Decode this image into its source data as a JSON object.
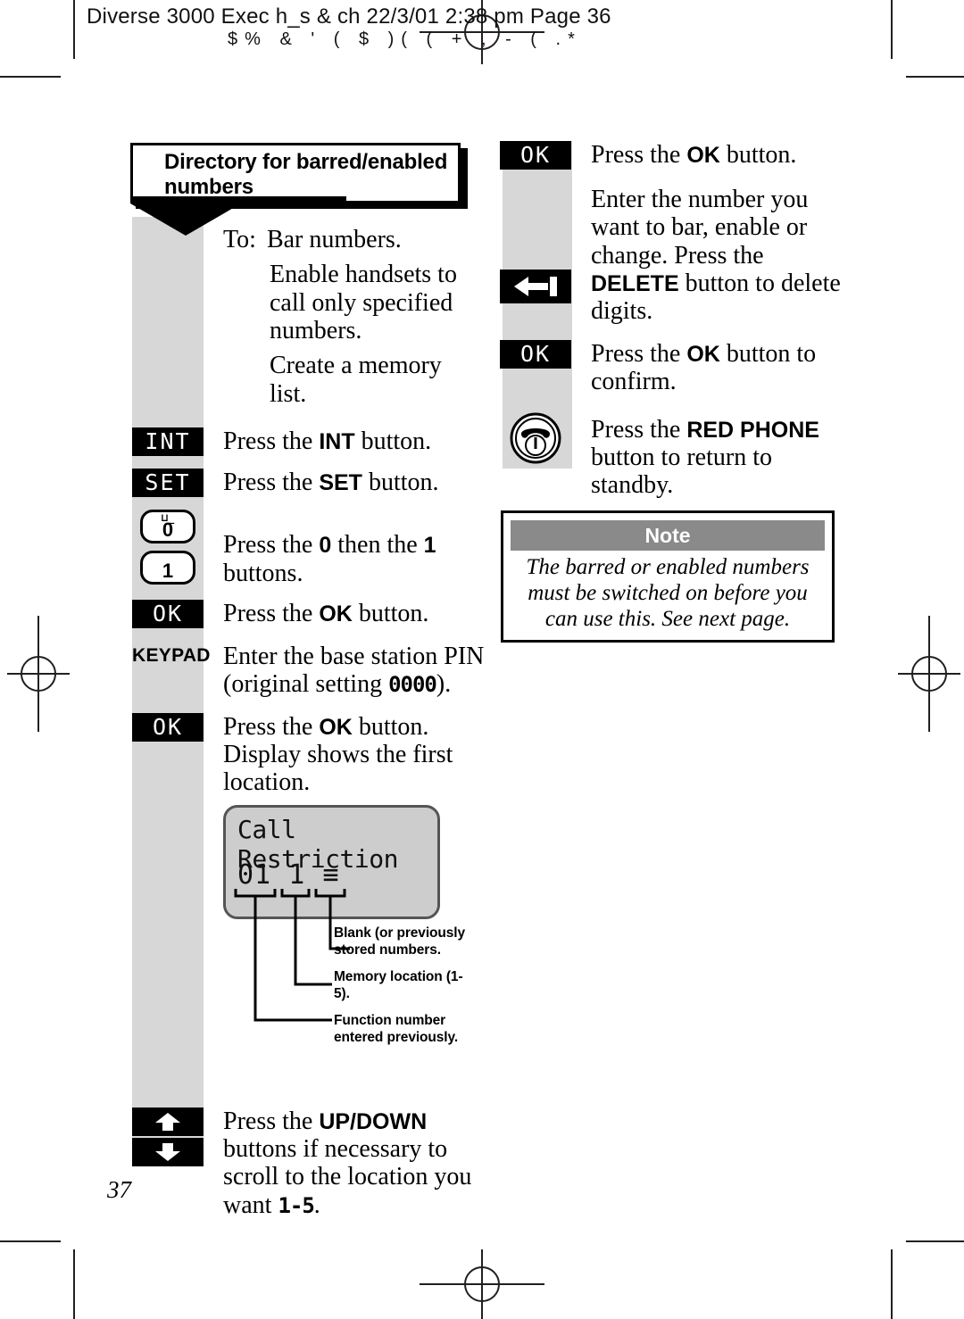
{
  "printer_header": {
    "line1": "Diverse 3000 Exec h_s & ch  22/3/01  2:38 pm  Page 36",
    "line2": "$%    &   '    ( $   )( ( + ,  -  ( .*"
  },
  "title": "Directory for barred/enabled numbers",
  "page_number": "37",
  "left_column": {
    "intro": {
      "label": "To:",
      "lines": [
        "Bar numbers.",
        "Enable handsets to call only specified numbers.",
        "Create a memory list."
      ]
    },
    "steps": [
      {
        "icon": "int-key",
        "icon_label": "INT",
        "text_html": "Press the <b>INT</b> button."
      },
      {
        "icon": "set-key",
        "icon_label": "SET",
        "text_html": "Press the <b>SET</b> button."
      },
      {
        "icon": "zero-one-keys",
        "key_zero": "0",
        "key_zero_sup": "⊔_",
        "key_one": "1",
        "text_html": "Press the <b>0</b> then the <b>1</b> buttons."
      },
      {
        "icon": "ok-key",
        "icon_label": "OK",
        "text_html": "Press the <b>OK</b> button."
      },
      {
        "icon": "keypad-label",
        "icon_label": "KEYPAD",
        "text_html": "Enter the base station PIN (original setting <span class=\"mono\">0000</span>)."
      },
      {
        "icon": "ok-key",
        "icon_label": "OK",
        "text_html": "Press the <b>OK</b> button. Display shows the first location."
      }
    ],
    "display": {
      "line1": "Call Restriction",
      "line2_location": "01",
      "line2_memory": "1",
      "line2_blank": "≡"
    },
    "display_annotations": [
      "Blank (or previously stored numbers.",
      "Memory location (1-5).",
      "Function number entered previously."
    ],
    "final_step": {
      "icon": "up-down-keys",
      "text_html": "Press the <b>UP/DOWN</b> buttons if necessary to scroll to the location you want <span class=\"mono\">1-5</span>."
    }
  },
  "right_column": {
    "steps": [
      {
        "icon": "ok-key",
        "icon_label": "OK",
        "text_html": "Press the <b>OK</b> button."
      },
      {
        "icon": "none",
        "text_html": "Enter the number you want to bar, enable or change. Press the"
      },
      {
        "icon": "delete-key",
        "text_html": "<b>DELETE</b> button to delete digits."
      },
      {
        "icon": "ok-key",
        "icon_label": "OK",
        "text_html": "Press the <b>OK</b> button to confirm."
      },
      {
        "icon": "red-phone-key",
        "text_html": "Press the <b>RED PHONE</b> button to return to standby."
      }
    ],
    "note": {
      "header": "Note",
      "body": "The barred or enabled numbers must be switched on before you can use this. See next page."
    }
  },
  "colors": {
    "key_black": "#000000",
    "rail_gray": "#d7d7d7",
    "lcd_gray": "#cdcdcd",
    "note_header_gray": "#8a8a8a"
  }
}
